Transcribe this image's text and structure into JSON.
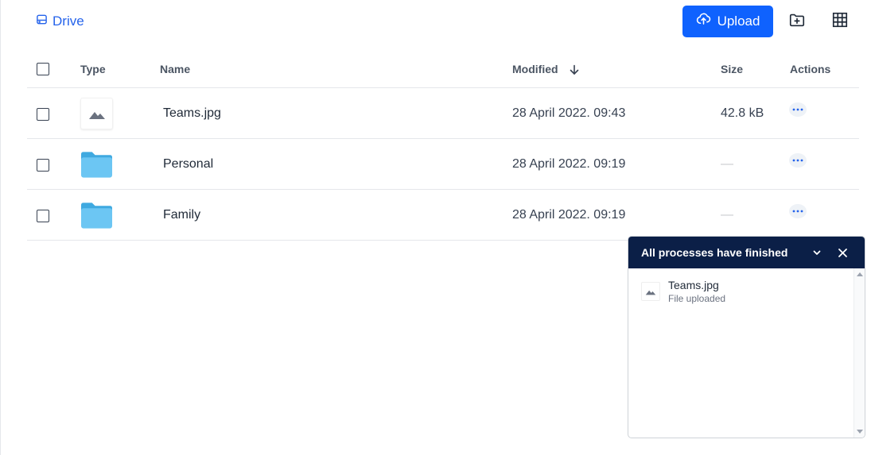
{
  "header": {
    "breadcrumb_label": "Drive",
    "upload_label": "Upload",
    "accent_color": "#0f62fe"
  },
  "table": {
    "columns": {
      "type": "Type",
      "name": "Name",
      "modified": "Modified",
      "size": "Size",
      "actions": "Actions"
    },
    "rows": [
      {
        "type": "image",
        "name": "Teams.jpg",
        "modified": "28 April 2022. 09:43",
        "size": "42.8 kB"
      },
      {
        "type": "folder",
        "name": "Personal",
        "modified": "28 April 2022. 09:19",
        "size": "—"
      },
      {
        "type": "folder",
        "name": "Family",
        "modified": "28 April 2022. 09:19",
        "size": "—"
      }
    ]
  },
  "process_panel": {
    "title": "All processes have finished",
    "header_color": "#0b1f47",
    "items": [
      {
        "name": "Teams.jpg",
        "status": "File uploaded"
      }
    ]
  }
}
